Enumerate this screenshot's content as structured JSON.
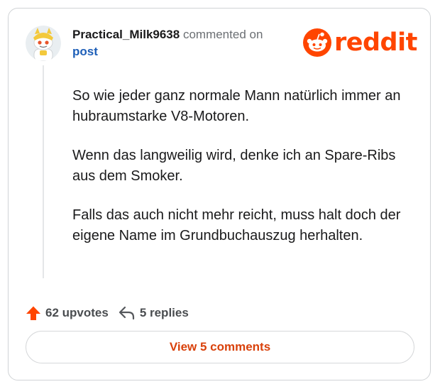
{
  "comment": {
    "username": "Practical_Milk9638",
    "action": "commented on",
    "post_link": "post",
    "paragraphs": [
      "So wie jeder ganz normale Mann natürlich immer an hubraumstarke V8-Motoren.",
      "Wenn das langweilig wird, denke ich an Spare-Ribs aus dem Smoker.",
      "Falls das auch nicht mehr reicht, muss halt doch der eigene Name im Grundbuchauszug herhalten."
    ]
  },
  "brand": {
    "logo_text": "reddit",
    "icon": "reddit-snoo-icon",
    "color": "#ff4500"
  },
  "stats": {
    "upvotes": "62 upvotes",
    "upvote_icon": "upvote-arrow-icon",
    "upvote_color": "#ff4500",
    "replies": "5 replies",
    "reply_icon": "reply-arrow-icon"
  },
  "actions": {
    "view_comments": "View 5 comments",
    "accent": "#d9410b"
  }
}
